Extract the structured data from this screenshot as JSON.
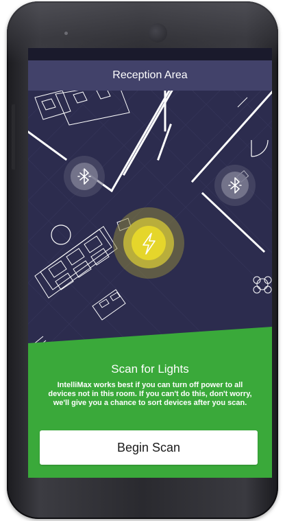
{
  "header": {
    "title": "Reception Area"
  },
  "map": {
    "devices": [
      {
        "name": "bluetooth-device-1",
        "icon": "bluetooth-icon"
      },
      {
        "name": "bluetooth-device-2",
        "icon": "bluetooth-icon"
      },
      {
        "name": "light-device",
        "icon": "lightning-bolt-icon"
      }
    ]
  },
  "panel": {
    "title": "Scan for Lights",
    "body": "IntelliMax works best if you can turn off power to all devices not in this room. If you can't do this, don't worry, we'll give you a chance to sort devices after you scan.",
    "button_label": "Begin Scan"
  },
  "colors": {
    "header_bg": "#42426a",
    "map_bg": "#2c2c4e",
    "panel_green": "#3aa93a",
    "light_yellow": "#e5d62b"
  }
}
